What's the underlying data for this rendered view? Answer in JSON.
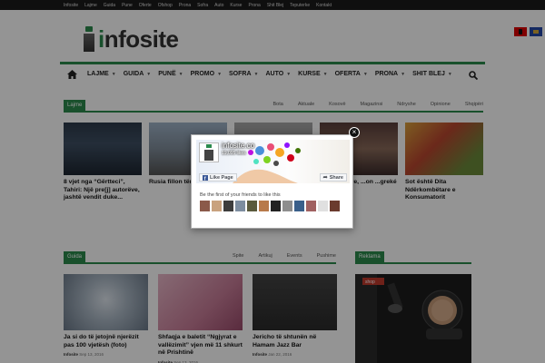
{
  "topbar": {
    "links": [
      "Infosite",
      "Lajme",
      "Guida",
      "Pune",
      "Oferte",
      "Ofshop",
      "Prona",
      "Sofra",
      "Auto",
      "Kurse",
      "Prona",
      "Shit Blej",
      "Teputerke",
      "Kontakt"
    ]
  },
  "logo": {
    "mark_letter": "i",
    "text_rest": "nfosite"
  },
  "nav": {
    "items": [
      "LAJME",
      "GUIDA",
      "PUNË",
      "PROMO",
      "SOFRA",
      "AUTO",
      "KURSE",
      "OFERTA",
      "PRONA",
      "SHIT BLEJ"
    ]
  },
  "lajme": {
    "label": "Lajme",
    "tabs": [
      "Bota",
      "Aktuale",
      "Kosovë",
      "Magazinsi",
      "Ndryshe",
      "Opinione",
      "Shqipëri"
    ],
    "cards": [
      {
        "title": "8 vjet nga “Gërtteci”, Tahiri: Një pre[j] autorëve, jashtë vendit duke..."
      },
      {
        "title": "Rusia fillon tërhe... Siria"
      },
      {
        "title": ""
      },
      {
        "title": "...ndestinëve, ...on ...greké dhe të"
      },
      {
        "title": "Sot është Dita Ndërkombëtare e Konsumatorit"
      }
    ]
  },
  "guida": {
    "label": "Guida",
    "tabs": [
      "Spite",
      "Artikuj",
      "Events",
      "Pushime"
    ],
    "cards": [
      {
        "title": "Ja si do të jetojnë njerëzit pas 100 vjetësh (foto)",
        "author": "Infosite",
        "date": "Sep 13, 2016"
      },
      {
        "title": "Shfaqja e baletit “Ngjyrat e vallëzimit” vjen më 11 shkurt në Prishtinë",
        "author": "Infosite",
        "date": "Sep 13, 2016"
      },
      {
        "title": "Jericho të shtunën në Hamam Jazz Bar",
        "author": "Infosite",
        "date": "Jan 22, 2016"
      }
    ]
  },
  "ad": {
    "label": "Reklama",
    "shop_text": "shop"
  },
  "fb_popup": {
    "page_name": "infosite.co",
    "likes": "19,095 likes",
    "like_button": "Like Page",
    "share_button": "Share",
    "friends_text": "Be the first of your friends to like this",
    "close_symbol": "×"
  },
  "colors": {
    "brand_green": "#2b8a4d",
    "topbar": "#1a1a1a",
    "fb_blue": "#3b5998"
  }
}
